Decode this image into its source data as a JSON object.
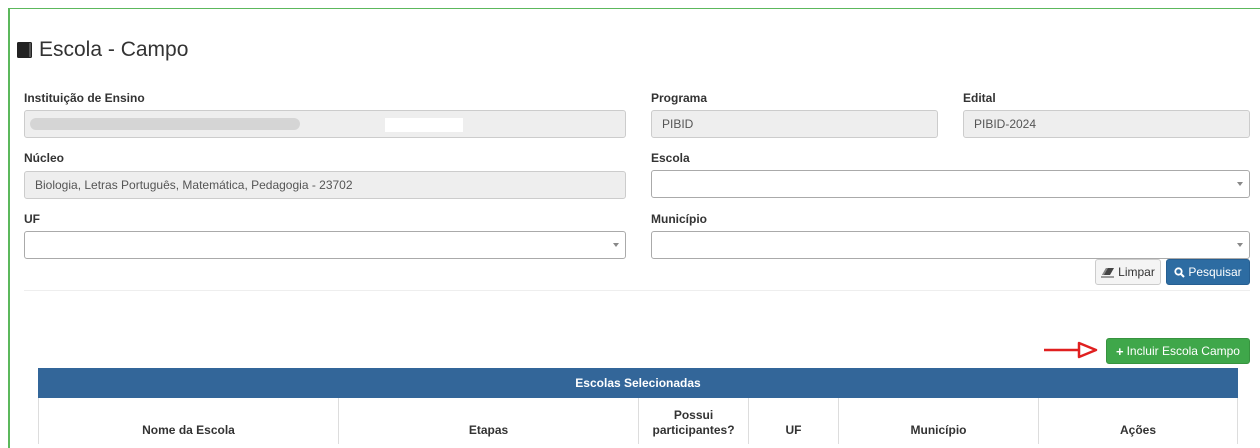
{
  "page": {
    "title": "Escola - Campo",
    "icon": "book-icon"
  },
  "filters": {
    "instituicao_label": "Instituição de Ensino",
    "instituicao_value": "",
    "programa_label": "Programa",
    "programa_value": "PIBID",
    "edital_label": "Edital",
    "edital_value": "PIBID-2024",
    "nucleo_label": "Núcleo",
    "nucleo_value": "Biologia, Letras Português, Matemática, Pedagogia - 23702",
    "escola_label": "Escola",
    "escola_value": "",
    "uf_label": "UF",
    "uf_value": "",
    "municipio_label": "Município",
    "municipio_value": ""
  },
  "actions": {
    "limpar_label": "Limpar",
    "pesquisar_label": "Pesquisar",
    "incluir_label": "Incluir Escola Campo"
  },
  "table": {
    "title": "Escolas Selecionadas",
    "columns": [
      "Nome da Escola",
      "Etapas",
      "Possui participantes?",
      "UF",
      "Município",
      "Ações"
    ]
  },
  "colors": {
    "primary": "#336699",
    "success": "#3fa74a",
    "annotation_arrow": "#e02020"
  }
}
